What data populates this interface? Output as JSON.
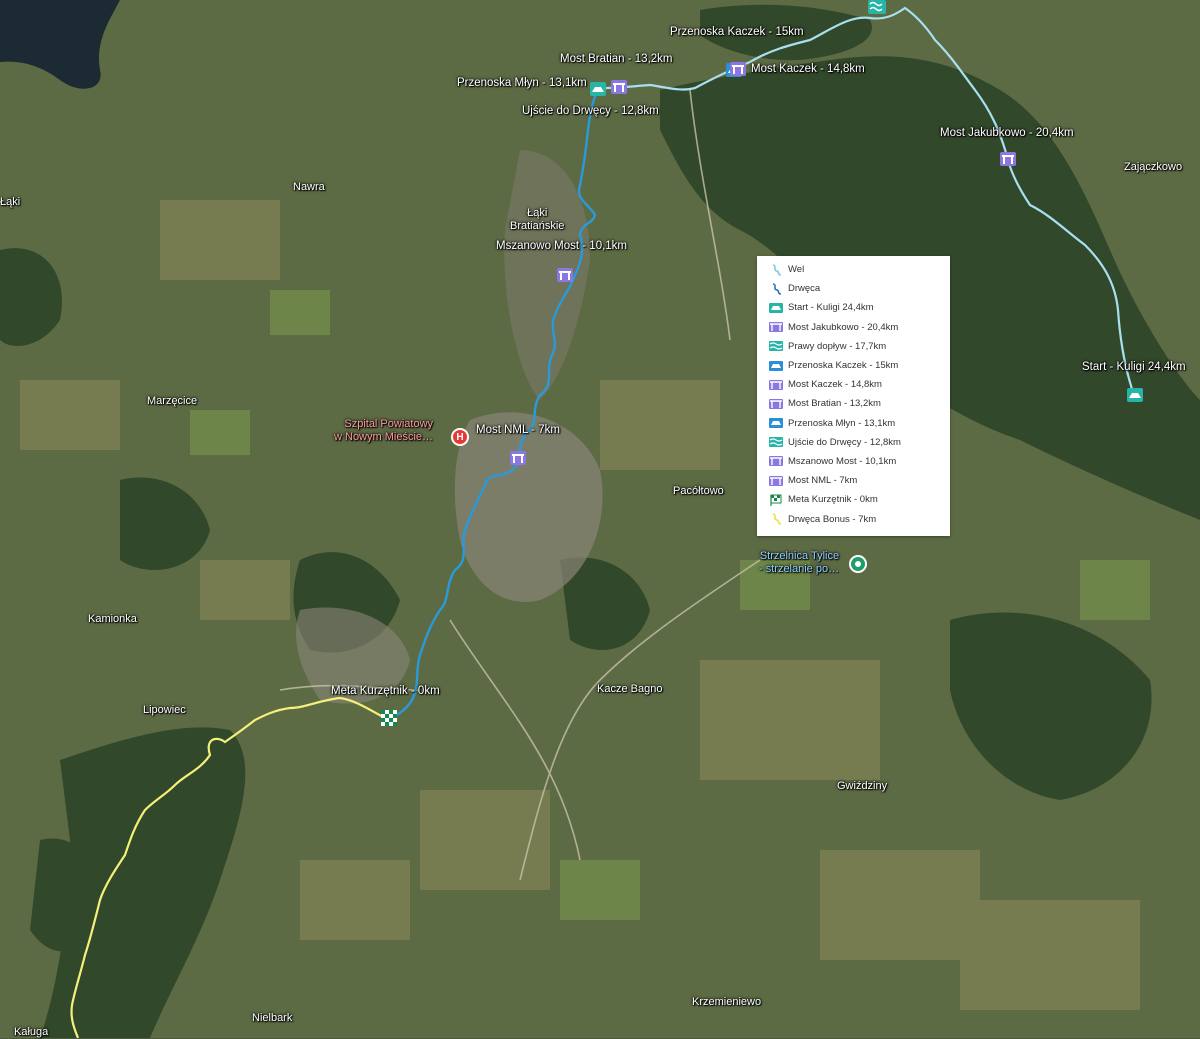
{
  "map": {
    "places": [
      {
        "id": "nawra",
        "text": "Nawra"
      },
      {
        "id": "laki",
        "text": "Łąki\nBratiańskie"
      },
      {
        "id": "marzecice",
        "text": "Marzęcice"
      },
      {
        "id": "kamionka",
        "text": "Kamionka"
      },
      {
        "id": "lipowiec",
        "text": "Lipowiec"
      },
      {
        "id": "pacoltowo",
        "text": "Pacółtowo"
      },
      {
        "id": "kacze",
        "text": "Kacze Bagno"
      },
      {
        "id": "gwizdziny",
        "text": "Gwiździny"
      },
      {
        "id": "krzemieniewo",
        "text": "Krzemieniewo"
      },
      {
        "id": "nielbark",
        "text": "Nielbark"
      },
      {
        "id": "kaluga",
        "text": "Kaługa"
      },
      {
        "id": "zajaczkowo",
        "text": "Zajączkowo"
      },
      {
        "id": "laki2",
        "text": "Łąki"
      }
    ],
    "hospital": {
      "text": "Szpital Powiatowy\nw Nowym Mieście…",
      "icon": "hospital-icon"
    },
    "poi": {
      "text": "Strzelnica Tylice\n- strzelanie po…",
      "icon": "location-pin-icon"
    },
    "route_labels": {
      "przenoska_kaczek": "Przenoska Kaczek - 15km",
      "most_bratian": "Most Bratian - 13,2km",
      "most_kaczek": "Most Kaczek - 14,8km",
      "przenoska_mlyn": "Przenoska Młyn - 13,1km",
      "ujscie": "Ujście do Drwęcy - 12,8km",
      "most_jakubkowo": "Most Jakubkowo - 20,4km",
      "mszanowo": "Mszanowo Most - 10,1km",
      "start": "Start - Kuligi 24,4km",
      "most_nml": "Most NML - 7km",
      "meta": "Meta Kurzętnik - 0km"
    },
    "colors": {
      "wel": "#a8e0f0",
      "drweca": "#2a9ad8",
      "bonus": "#f5f07a",
      "bridge": "#8a78e0",
      "kayak": "#26b5a6",
      "finish": "#138a4a"
    }
  },
  "legend": {
    "items": [
      {
        "label": "Wel",
        "icon": "river-line-icon",
        "color": "#7ec8e3"
      },
      {
        "label": "Drwęca",
        "icon": "river-line-icon",
        "color": "#2a6fb8"
      },
      {
        "label": "Start - Kuligi 24,4km",
        "icon": "kayak-icon",
        "color": "#26b5a6"
      },
      {
        "label": "Most Jakubkowo - 20,4km",
        "icon": "bridge-icon",
        "color": "#8a78e0"
      },
      {
        "label": "Prawy dopływ - 17,7km",
        "icon": "water-icon",
        "color": "#26b5a6"
      },
      {
        "label": "Przenoska Kaczek - 15km",
        "icon": "portage-icon",
        "color": "#2a8fd8"
      },
      {
        "label": "Most Kaczek - 14,8km",
        "icon": "bridge-icon",
        "color": "#8a78e0"
      },
      {
        "label": "Most Bratian - 13,2km",
        "icon": "bridge-icon",
        "color": "#8a78e0"
      },
      {
        "label": "Przenoska Młyn - 13,1km",
        "icon": "portage-icon",
        "color": "#2a8fd8"
      },
      {
        "label": "Ujście do Drwęcy - 12,8km",
        "icon": "water-icon",
        "color": "#26b5a6"
      },
      {
        "label": "Mszanowo Most - 10,1km",
        "icon": "bridge-icon",
        "color": "#8a78e0"
      },
      {
        "label": "Most NML - 7km",
        "icon": "bridge-icon",
        "color": "#8a78e0"
      },
      {
        "label": "Meta Kurzętnik - 0km",
        "icon": "checkered-flag-icon",
        "color": "#138a4a"
      },
      {
        "label": "Drwęca Bonus - 7km",
        "icon": "river-line-icon",
        "color": "#e8e040"
      }
    ]
  }
}
